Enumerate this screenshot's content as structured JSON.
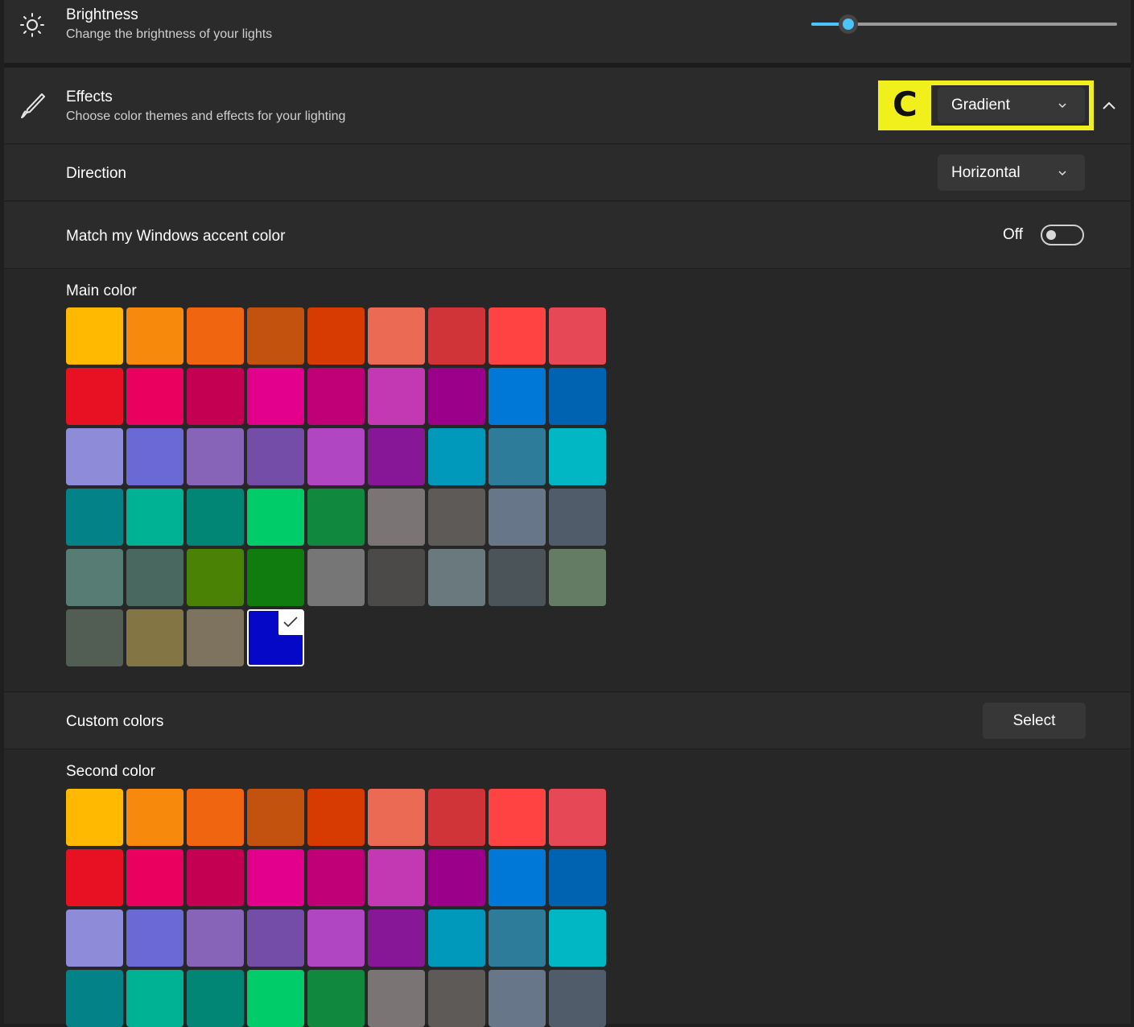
{
  "brightness": {
    "title": "Brightness",
    "subtitle": "Change the brightness of your lights",
    "value_fraction": 0.12,
    "icon": "sun-icon"
  },
  "effects": {
    "title": "Effects",
    "subtitle": "Choose color themes and effects for your lighting",
    "icon": "brush-icon",
    "annotation_letter": "C",
    "selected": "Gradient"
  },
  "direction": {
    "label": "Direction",
    "selected": "Horizontal"
  },
  "accent": {
    "label": "Match my Windows accent color",
    "state": "Off"
  },
  "main_color": {
    "label": "Main color",
    "selected_index": 48
  },
  "custom_colors": {
    "label": "Custom colors",
    "button": "Select"
  },
  "second_color": {
    "label": "Second color"
  },
  "palette": [
    "#ffb900",
    "#f7890c",
    "#f0650f",
    "#c4520f",
    "#d83b01",
    "#ea6a53",
    "#d13438",
    "#ff4343",
    "#e74856",
    "#e81123",
    "#ea005e",
    "#c30052",
    "#e3008c",
    "#bf0077",
    "#c239b3",
    "#9a0089",
    "#0078d7",
    "#0063b1",
    "#8e8cd8",
    "#6b69d6",
    "#8764b8",
    "#744da9",
    "#b146c2",
    "#881798",
    "#0099bc",
    "#2d7d9a",
    "#00b7c3",
    "#038387",
    "#00b294",
    "#018574",
    "#00cc6a",
    "#10893e",
    "#7a7574",
    "#5d5a58",
    "#68768a",
    "#515c6b",
    "#567c73",
    "#486860",
    "#498205",
    "#107c10",
    "#767676",
    "#4c4a48",
    "#69797e",
    "#4a5459",
    "#647c64",
    "#525e54",
    "#847545",
    "#7e735f",
    "#0508c6"
  ]
}
